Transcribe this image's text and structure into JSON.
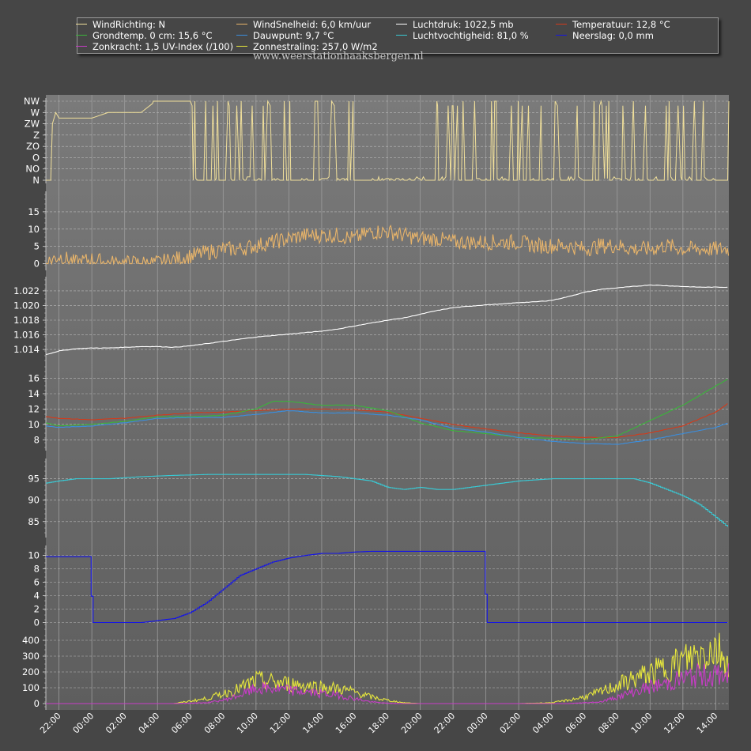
{
  "chart_data": {
    "type": "line",
    "legend": [
      {
        "label": "WindRichting: N",
        "color": "#f0df9a"
      },
      {
        "label": "WindSnelheid: 6,0 km/uur",
        "color": "#e8b46a"
      },
      {
        "label": "Luchtdruk: 1022,5 mb",
        "color": "#ffffff"
      },
      {
        "label": "Temperatuur: 12,8 °C",
        "color": "#d43a1a"
      },
      {
        "label": "Grondtemp. 0 cm: 15,6 °C",
        "color": "#3ab53a"
      },
      {
        "label": "Dauwpunt: 9,7 °C",
        "color": "#3a8fe0"
      },
      {
        "label": "Luchtvochtigheid: 81,0 %",
        "color": "#39c9d4"
      },
      {
        "label": "Neerslag: 0,0 mm",
        "color": "#1414e8"
      },
      {
        "label": "Zonkracht: 1,5 UV-Index (/100)",
        "color": "#c83cc8"
      },
      {
        "label": "Zonnestraling: 257,0 W/m2",
        "color": "#e8e83c"
      }
    ],
    "watermark": "www.weerstationhaaksbergen.nl",
    "x_tick_labels": [
      "22:00",
      "00:00",
      "02:00",
      "04:00",
      "06:00",
      "08:00",
      "10:00",
      "12:00",
      "14:00",
      "16:00",
      "18:00",
      "20:00",
      "22:00",
      "00:00",
      "02:00",
      "04:00",
      "06:00",
      "08:00",
      "10:00",
      "12:00",
      "14:00"
    ],
    "x_range_hours": [
      21.2,
      62.8
    ],
    "panels": [
      {
        "name": "wind-direction",
        "ylim": [
          0,
          7
        ],
        "tick_labels": [
          "N",
          "NO",
          "O",
          "ZO",
          "Z",
          "ZW",
          "W",
          "NW"
        ],
        "series": [
          {
            "color": "#f0df9a",
            "kind": "direction",
            "x": [
              21.2,
              21.5,
              21.6,
              21.8,
              22,
              23,
              24,
              25,
              26,
              27,
              27.7,
              27.75,
              28,
              29,
              30
            ],
            "y": [
              0,
              0,
              5,
              6,
              5.5,
              5.5,
              5.5,
              6,
              6,
              6,
              6.8,
              7,
              7,
              7,
              7
            ]
          }
        ]
      },
      {
        "name": "wind-speed",
        "ylim": [
          -1,
          20
        ],
        "tick_values": [
          0,
          5,
          10,
          15
        ],
        "series": [
          {
            "color": "#e8b46a",
            "kind": "noisy",
            "x": [
              21.2,
              22,
              23,
              24,
              25,
              26,
              27,
              28,
              29,
              30,
              31,
              32,
              33,
              34,
              35,
              36,
              37,
              38,
              39,
              40,
              41,
              42,
              43,
              44,
              45,
              46,
              47,
              48,
              49,
              50,
              51,
              52,
              53,
              54,
              55,
              56,
              57,
              58,
              59,
              60,
              61,
              62,
              62.8
            ],
            "y": [
              0,
              2,
              0,
              1,
              0,
              0,
              0,
              0,
              1,
              2,
              3,
              4,
              4,
              5,
              6,
              7,
              8,
              8,
              8,
              7,
              9,
              9,
              8,
              7,
              7,
              6,
              6,
              6,
              6,
              6,
              5,
              5,
              5,
              4,
              5,
              5,
              4,
              4,
              5,
              4,
              4,
              4,
              4
            ]
          }
        ]
      },
      {
        "name": "air-pressure",
        "ylim": [
          1.0125,
          1.0235
        ],
        "tick_values": [
          1.014,
          1.016,
          1.018,
          1.02,
          1.022
        ],
        "tick_labels": [
          "1.014",
          "1.016",
          "1.018",
          "1.020",
          "1.022"
        ],
        "series": [
          {
            "color": "#ffffff",
            "kind": "smooth",
            "x": [
              21.2,
              22,
              23,
              24,
              25,
              26,
              27,
              28,
              29,
              30,
              31,
              32,
              33,
              34,
              35,
              36,
              37,
              38,
              39,
              40,
              41,
              42,
              43,
              44,
              45,
              46,
              47,
              48,
              49,
              50,
              51,
              52,
              53,
              54,
              55,
              56,
              57,
              58,
              59,
              60,
              61,
              62,
              62.8
            ],
            "y": [
              1.0133,
              1.0138,
              1.0141,
              1.0142,
              1.0142,
              1.0143,
              1.0144,
              1.0144,
              1.0143,
              1.0145,
              1.0148,
              1.0151,
              1.0154,
              1.0157,
              1.0159,
              1.0161,
              1.0163,
              1.0165,
              1.0168,
              1.0172,
              1.0176,
              1.018,
              1.0183,
              1.0188,
              1.0193,
              1.0197,
              1.0199,
              1.0201,
              1.0202,
              1.0204,
              1.0205,
              1.0207,
              1.0212,
              1.0218,
              1.0222,
              1.0224,
              1.0226,
              1.0228,
              1.0227,
              1.0226,
              1.0225,
              1.0225,
              1.0225
            ]
          }
        ]
      },
      {
        "name": "temperature",
        "ylim": [
          7,
          17.5
        ],
        "tick_values": [
          8,
          10,
          12,
          14,
          16
        ],
        "series": [
          {
            "name": "Temperatuur",
            "color": "#d43a1a",
            "kind": "smooth",
            "x": [
              21.2,
              22,
              24,
              26,
              28,
              30,
              32,
              34,
              36,
              38,
              40,
              42,
              44,
              46,
              48,
              50,
              52,
              54,
              56,
              58,
              60,
              62,
              62.8
            ],
            "y": [
              11,
              10.8,
              10.6,
              10.8,
              11.2,
              11.5,
              11.6,
              11.8,
              12,
              12,
              11.9,
              11.6,
              10.8,
              10,
              9.4,
              8.9,
              8.5,
              8.3,
              8.3,
              8.9,
              9.8,
              11.6,
              12.8
            ]
          },
          {
            "name": "Grondtemp. 0 cm",
            "color": "#3ab53a",
            "kind": "smooth",
            "x": [
              21.2,
              22,
              24,
              26,
              28,
              30,
              32,
              34,
              35,
              36,
              38,
              40,
              42,
              44,
              46,
              48,
              50,
              52,
              54,
              56,
              58,
              60,
              62,
              62.8
            ],
            "y": [
              10.2,
              9.8,
              10,
              10.4,
              11,
              11,
              11.2,
              12,
              13,
              13,
              12.5,
              12.5,
              11.8,
              10.2,
              9.2,
              8.8,
              8.3,
              8.2,
              8,
              8.5,
              10.5,
              12.5,
              15,
              16
            ]
          },
          {
            "name": "Dauwpunt",
            "color": "#3a8fe0",
            "kind": "smooth",
            "x": [
              21.2,
              22,
              24,
              26,
              28,
              30,
              32,
              34,
              36,
              38,
              40,
              42,
              44,
              46,
              48,
              50,
              52,
              54,
              56,
              58,
              60,
              62,
              62.8
            ],
            "y": [
              9.8,
              9.6,
              9.8,
              10.2,
              10.8,
              10.9,
              10.9,
              11.3,
              11.8,
              11.5,
              11.5,
              11.2,
              10.6,
              9.5,
              9,
              8.3,
              7.8,
              7.5,
              7.4,
              8,
              8.8,
              9.6,
              10.2
            ]
          }
        ]
      },
      {
        "name": "humidity",
        "ylim": [
          82,
          99
        ],
        "tick_values": [
          85,
          90,
          95
        ],
        "series": [
          {
            "color": "#39c9d4",
            "kind": "step",
            "x": [
              21.2,
              22,
              23,
              25,
              27,
              29,
              31,
              32,
              33,
              35,
              37,
              39,
              40,
              41,
              42,
              43,
              44,
              45,
              46,
              47,
              48,
              50,
              52,
              54,
              56,
              57,
              58,
              59,
              60,
              61,
              62,
              62.8
            ],
            "y": [
              94,
              94.5,
              95,
              95,
              95.5,
              95.8,
              96,
              96,
              96,
              96,
              96,
              95.5,
              95,
              94.5,
              93,
              92.5,
              93,
              92.5,
              92.5,
              93,
              93.5,
              94.5,
              95,
              95,
              95,
              95,
              94,
              92.5,
              91,
              89,
              86,
              83.5
            ]
          }
        ]
      },
      {
        "name": "precipitation",
        "ylim": [
          -1,
          11
        ],
        "tick_values": [
          0,
          2,
          4,
          6,
          8,
          10
        ],
        "series": [
          {
            "color": "#1414e8",
            "kind": "step",
            "x": [
              21.2,
              23.9,
              24,
              27,
              28,
              29,
              30,
              31,
              32,
              33,
              34,
              35,
              36,
              37,
              38,
              39,
              40,
              41,
              42,
              43,
              44,
              45,
              46,
              47,
              47.9,
              48,
              62.8
            ],
            "y": [
              9.8,
              9.8,
              0,
              0,
              0.3,
              0.6,
              1.5,
              3,
              5,
              7,
              8,
              9,
              9.6,
              10,
              10.3,
              10.3,
              10.5,
              10.6,
              10.6,
              10.6,
              10.6,
              10.6,
              10.6,
              10.6,
              10.6,
              0,
              0
            ]
          }
        ]
      },
      {
        "name": "solar",
        "ylim": [
          -20,
          430
        ],
        "tick_values": [
          0,
          100,
          200,
          300,
          400
        ],
        "series": [
          {
            "name": "Zonnestraling",
            "color": "#e8e83c",
            "kind": "noisy",
            "x": [
              21.2,
              29,
              30,
              31,
              32,
              33,
              34,
              35,
              36,
              37,
              38,
              39,
              40,
              41,
              42,
              43,
              44,
              45,
              50,
              52,
              53,
              54,
              55,
              56,
              57,
              58,
              59,
              60,
              61,
              62,
              62.8
            ],
            "y": [
              0,
              0,
              15,
              30,
              60,
              90,
              140,
              130,
              120,
              110,
              100,
              90,
              70,
              40,
              20,
              5,
              0,
              0,
              0,
              5,
              20,
              40,
              70,
              110,
              150,
              180,
              220,
              260,
              300,
              340,
              260
            ]
          },
          {
            "name": "Zonkracht",
            "color": "#c83cc8",
            "kind": "noisy",
            "x": [
              21.2,
              29,
              31,
              32,
              33,
              34,
              35,
              36,
              37,
              38,
              39,
              40,
              41,
              42,
              43,
              44,
              53,
              55,
              56,
              57,
              58,
              59,
              60,
              61,
              62,
              62.8
            ],
            "y": [
              0,
              0,
              5,
              20,
              50,
              90,
              90,
              80,
              70,
              60,
              50,
              30,
              10,
              2,
              0,
              0,
              0,
              10,
              40,
              70,
              100,
              120,
              150,
              170,
              170,
              170
            ]
          }
        ]
      }
    ]
  }
}
